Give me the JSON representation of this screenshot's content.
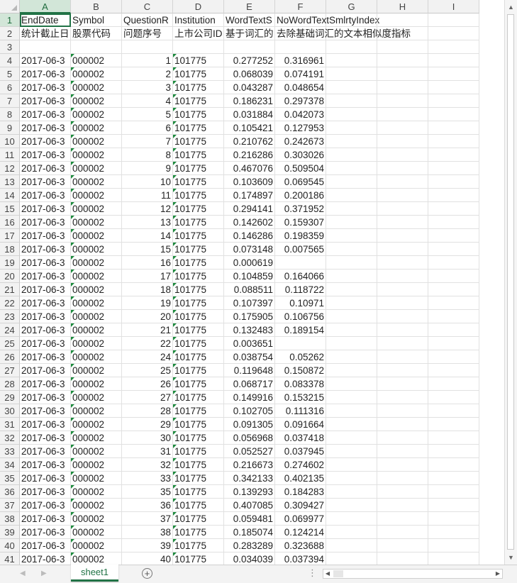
{
  "columns": [
    "A",
    "B",
    "C",
    "D",
    "E",
    "F",
    "G",
    "H",
    "I"
  ],
  "rows": [
    {
      "n": "1",
      "cells": [
        "EndDate",
        "Symbol",
        "QuestionR",
        "Institution",
        "WordTextS",
        "NoWordTextSmlrtyIndex",
        "",
        "",
        ""
      ]
    },
    {
      "n": "2",
      "cells": [
        "统计截止日",
        "股票代码",
        "问题序号",
        "上市公司ID",
        "基于词汇的",
        "去除基础词汇的文本相似度指标",
        "",
        "",
        ""
      ]
    },
    {
      "n": "3",
      "cells": [
        "",
        "",
        "",
        "",
        "",
        "",
        "",
        "",
        ""
      ]
    },
    {
      "n": "4",
      "cells": [
        "2017-06-3",
        "000002",
        "1",
        "101775",
        "0.277252",
        "0.316961",
        "",
        "",
        ""
      ]
    },
    {
      "n": "5",
      "cells": [
        "2017-06-3",
        "000002",
        "2",
        "101775",
        "0.068039",
        "0.074191",
        "",
        "",
        ""
      ]
    },
    {
      "n": "6",
      "cells": [
        "2017-06-3",
        "000002",
        "3",
        "101775",
        "0.043287",
        "0.048654",
        "",
        "",
        ""
      ]
    },
    {
      "n": "7",
      "cells": [
        "2017-06-3",
        "000002",
        "4",
        "101775",
        "0.186231",
        "0.297378",
        "",
        "",
        ""
      ]
    },
    {
      "n": "8",
      "cells": [
        "2017-06-3",
        "000002",
        "5",
        "101775",
        "0.031884",
        "0.042073",
        "",
        "",
        ""
      ]
    },
    {
      "n": "9",
      "cells": [
        "2017-06-3",
        "000002",
        "6",
        "101775",
        "0.105421",
        "0.127953",
        "",
        "",
        ""
      ]
    },
    {
      "n": "10",
      "cells": [
        "2017-06-3",
        "000002",
        "7",
        "101775",
        "0.210762",
        "0.242673",
        "",
        "",
        ""
      ]
    },
    {
      "n": "11",
      "cells": [
        "2017-06-3",
        "000002",
        "8",
        "101775",
        "0.216286",
        "0.303026",
        "",
        "",
        ""
      ]
    },
    {
      "n": "12",
      "cells": [
        "2017-06-3",
        "000002",
        "9",
        "101775",
        "0.467076",
        "0.509504",
        "",
        "",
        ""
      ]
    },
    {
      "n": "13",
      "cells": [
        "2017-06-3",
        "000002",
        "10",
        "101775",
        "0.103609",
        "0.069545",
        "",
        "",
        ""
      ]
    },
    {
      "n": "14",
      "cells": [
        "2017-06-3",
        "000002",
        "11",
        "101775",
        "0.174897",
        "0.200186",
        "",
        "",
        ""
      ]
    },
    {
      "n": "15",
      "cells": [
        "2017-06-3",
        "000002",
        "12",
        "101775",
        "0.294141",
        "0.371952",
        "",
        "",
        ""
      ]
    },
    {
      "n": "16",
      "cells": [
        "2017-06-3",
        "000002",
        "13",
        "101775",
        "0.142602",
        "0.159307",
        "",
        "",
        ""
      ]
    },
    {
      "n": "17",
      "cells": [
        "2017-06-3",
        "000002",
        "14",
        "101775",
        "0.146286",
        "0.198359",
        "",
        "",
        ""
      ]
    },
    {
      "n": "18",
      "cells": [
        "2017-06-3",
        "000002",
        "15",
        "101775",
        "0.073148",
        "0.007565",
        "",
        "",
        ""
      ]
    },
    {
      "n": "19",
      "cells": [
        "2017-06-3",
        "000002",
        "16",
        "101775",
        "0.000619",
        "",
        "",
        "",
        ""
      ]
    },
    {
      "n": "20",
      "cells": [
        "2017-06-3",
        "000002",
        "17",
        "101775",
        "0.104859",
        "0.164066",
        "",
        "",
        ""
      ]
    },
    {
      "n": "21",
      "cells": [
        "2017-06-3",
        "000002",
        "18",
        "101775",
        "0.088511",
        "0.118722",
        "",
        "",
        ""
      ]
    },
    {
      "n": "22",
      "cells": [
        "2017-06-3",
        "000002",
        "19",
        "101775",
        "0.107397",
        "0.10971",
        "",
        "",
        ""
      ]
    },
    {
      "n": "23",
      "cells": [
        "2017-06-3",
        "000002",
        "20",
        "101775",
        "0.175905",
        "0.106756",
        "",
        "",
        ""
      ]
    },
    {
      "n": "24",
      "cells": [
        "2017-06-3",
        "000002",
        "21",
        "101775",
        "0.132483",
        "0.189154",
        "",
        "",
        ""
      ]
    },
    {
      "n": "25",
      "cells": [
        "2017-06-3",
        "000002",
        "22",
        "101775",
        "0.003651",
        "",
        "",
        "",
        ""
      ]
    },
    {
      "n": "26",
      "cells": [
        "2017-06-3",
        "000002",
        "24",
        "101775",
        "0.038754",
        "0.05262",
        "",
        "",
        ""
      ]
    },
    {
      "n": "27",
      "cells": [
        "2017-06-3",
        "000002",
        "25",
        "101775",
        "0.119648",
        "0.150872",
        "",
        "",
        ""
      ]
    },
    {
      "n": "28",
      "cells": [
        "2017-06-3",
        "000002",
        "26",
        "101775",
        "0.068717",
        "0.083378",
        "",
        "",
        ""
      ]
    },
    {
      "n": "29",
      "cells": [
        "2017-06-3",
        "000002",
        "27",
        "101775",
        "0.149916",
        "0.153215",
        "",
        "",
        ""
      ]
    },
    {
      "n": "30",
      "cells": [
        "2017-06-3",
        "000002",
        "28",
        "101775",
        "0.102705",
        "0.111316",
        "",
        "",
        ""
      ]
    },
    {
      "n": "31",
      "cells": [
        "2017-06-3",
        "000002",
        "29",
        "101775",
        "0.091305",
        "0.091664",
        "",
        "",
        ""
      ]
    },
    {
      "n": "32",
      "cells": [
        "2017-06-3",
        "000002",
        "30",
        "101775",
        "0.056968",
        "0.037418",
        "",
        "",
        ""
      ]
    },
    {
      "n": "33",
      "cells": [
        "2017-06-3",
        "000002",
        "31",
        "101775",
        "0.052527",
        "0.037945",
        "",
        "",
        ""
      ]
    },
    {
      "n": "34",
      "cells": [
        "2017-06-3",
        "000002",
        "32",
        "101775",
        "0.216673",
        "0.274602",
        "",
        "",
        ""
      ]
    },
    {
      "n": "35",
      "cells": [
        "2017-06-3",
        "000002",
        "33",
        "101775",
        "0.342133",
        "0.402135",
        "",
        "",
        ""
      ]
    },
    {
      "n": "36",
      "cells": [
        "2017-06-3",
        "000002",
        "35",
        "101775",
        "0.139293",
        "0.184283",
        "",
        "",
        ""
      ]
    },
    {
      "n": "37",
      "cells": [
        "2017-06-3",
        "000002",
        "36",
        "101775",
        "0.407085",
        "0.309427",
        "",
        "",
        ""
      ]
    },
    {
      "n": "38",
      "cells": [
        "2017-06-3",
        "000002",
        "37",
        "101775",
        "0.059481",
        "0.069977",
        "",
        "",
        ""
      ]
    },
    {
      "n": "39",
      "cells": [
        "2017-06-3",
        "000002",
        "38",
        "101775",
        "0.185074",
        "0.124214",
        "",
        "",
        ""
      ]
    },
    {
      "n": "40",
      "cells": [
        "2017-06-3",
        "000002",
        "39",
        "101775",
        "0.283289",
        "0.323688",
        "",
        "",
        ""
      ]
    },
    {
      "n": "41",
      "cells": [
        "2017-06-3",
        "000002",
        "40",
        "101775",
        "0.034039",
        "0.037394",
        "",
        "",
        ""
      ]
    }
  ],
  "sheet_tab": "sheet1",
  "add_sheet": "+",
  "dots": "⋮",
  "scroll_up": "▲",
  "scroll_down": "▼",
  "scroll_left": "◀",
  "scroll_right": "▶",
  "nav_prev": "◀",
  "nav_next": "▶",
  "accent": "#217346"
}
